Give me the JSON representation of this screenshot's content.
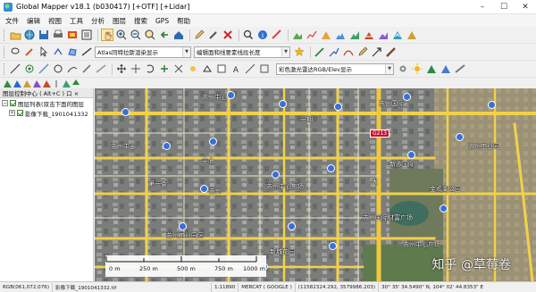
{
  "window": {
    "title": "Global Mapper v18.1 (b030417) [+OTF] [+Lidar]",
    "minimize_glyph": "–",
    "maximize_glyph": "☐",
    "close_glyph": "✕"
  },
  "menu": [
    "文件",
    "编辑",
    "视图",
    "工具",
    "分析",
    "图层",
    "搜索",
    "GPS",
    "帮助"
  ],
  "toolbars": {
    "combo_atlas": "Atlas同特拉斯渲染显示",
    "combo_edit": "编辑面和线要素线段长度",
    "combo_shader": "彩色激光雷达RGB/Elev显示"
  },
  "left_panel": {
    "header": "图层控制中心 ( Alt+C ) 口 ×",
    "tree": [
      {
        "label": "图层列表(双击下面的图层",
        "expander": "−"
      },
      {
        "label": "影像下载_1901041332",
        "expander": "+"
      }
    ]
  },
  "map": {
    "labels": [
      "苏州中心",
      "苏州国际",
      "一期",
      "苏州中心",
      "中心",
      "新苏国际",
      "苏州工业园",
      "第一街",
      "苏州中心广场",
      "苏州",
      "大",
      "苏州国际财富广场",
      "金鸡湖公园",
      "苏州工业园区",
      "新城花园",
      "苏州中心广场"
    ],
    "road_sign": "G213",
    "watermark": "知乎 @草莓卷",
    "scale": {
      "labels": [
        "0 m",
        "250 m",
        "500 m",
        "750 m",
        "1000 m"
      ]
    }
  },
  "status": {
    "rgb": "RGB(061,072,076)",
    "layer": "影像下载_1901041332.tif",
    "scale": "1:11890",
    "projection": "MERCAT ( GOOGLE )",
    "xy": "(11582324.292, 3579986.203)",
    "latlon": "30° 35' 34.5490\" N, 104° 02' 44.8353\" E"
  },
  "colors": {
    "accent_blue": "#3b6fd8",
    "road_yellow": "#f2d14a",
    "sign_red": "#c8102e"
  }
}
